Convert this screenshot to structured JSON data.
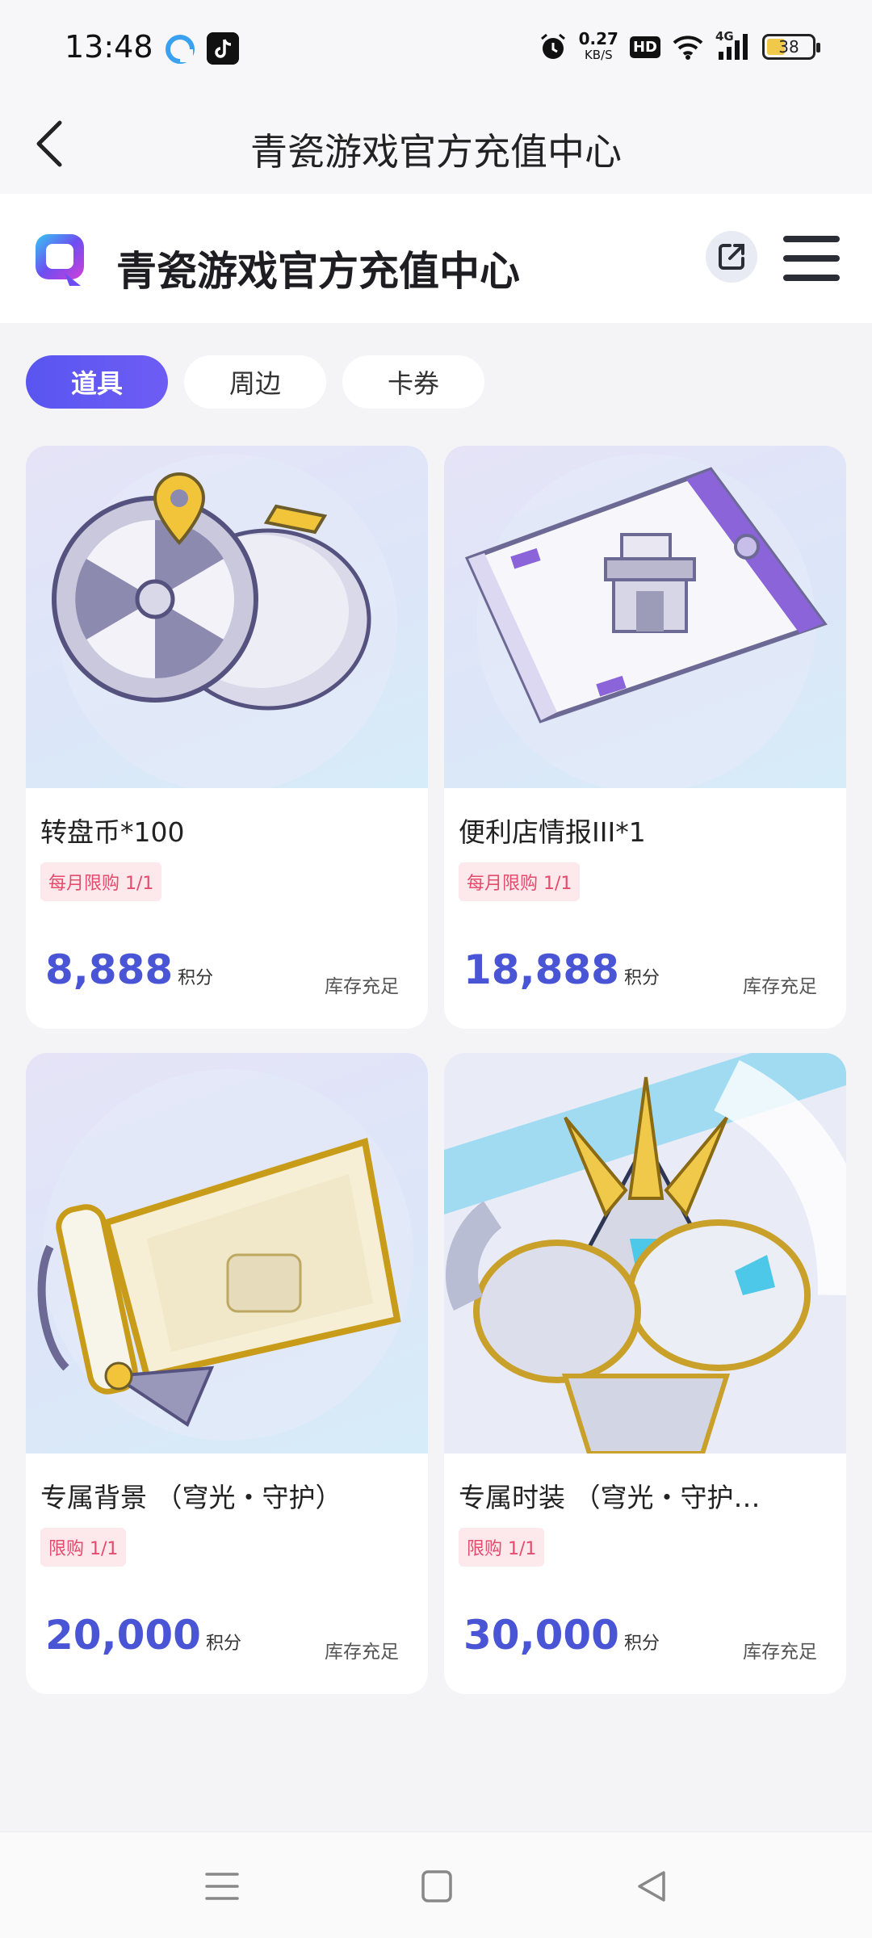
{
  "status_bar": {
    "time": "13:48",
    "net_speed": "0.27",
    "net_unit": "KB/S",
    "hd": "HD",
    "network": "4G",
    "battery": "38",
    "icons": [
      "app-icon",
      "tiktok-icon",
      "alarm-icon",
      "wifi-icon",
      "signal-icon"
    ]
  },
  "title_bar": {
    "title": "青瓷游戏官方充值中心",
    "back_icon": "chevron-left-icon"
  },
  "header": {
    "site_title": "青瓷游戏官方充值中心",
    "logo_icon": "q-logo-icon",
    "share_icon": "external-link-icon",
    "menu_icon": "hamburger-menu-icon"
  },
  "tabs": [
    {
      "label": "道具",
      "active": true
    },
    {
      "label": "周边",
      "active": false
    },
    {
      "label": "卡券",
      "active": false
    }
  ],
  "products": [
    {
      "name": "转盘币*100",
      "limit": "每月限购 1/1",
      "price": "8,888",
      "unit": "积分",
      "stock": "库存充足",
      "image": "coin-image"
    },
    {
      "name": "便利店情报III*1",
      "limit": "每月限购 1/1",
      "price": "18,888",
      "unit": "积分",
      "stock": "库存充足",
      "image": "ticket-image"
    },
    {
      "name": "专属背景 （穹光・守护）",
      "limit": "限购 1/1",
      "price": "20,000",
      "unit": "积分",
      "stock": "库存充足",
      "image": "scroll-image"
    },
    {
      "name": "专属时装 （穹光・守护…",
      "limit": "限购 1/1",
      "price": "30,000",
      "unit": "积分",
      "stock": "库存充足",
      "image": "armor-image"
    }
  ],
  "colors": {
    "accent": "#5a55f0",
    "price": "#4a55d6",
    "badge_text": "#e44b6c",
    "badge_bg": "#fde8ec"
  },
  "nav_bar": {
    "icons": [
      "menu-lines-icon",
      "home-square-icon",
      "back-triangle-icon"
    ]
  }
}
